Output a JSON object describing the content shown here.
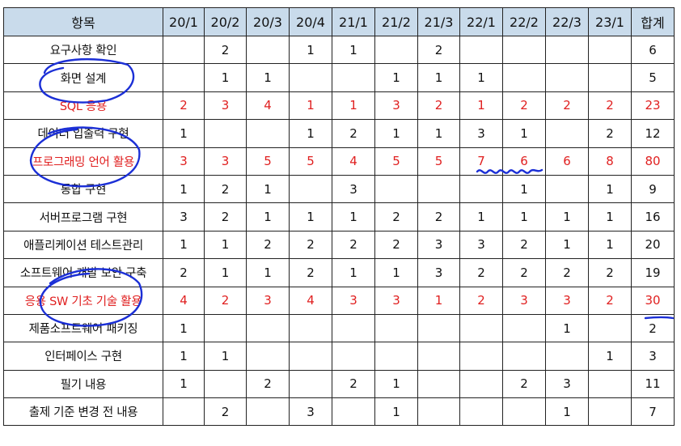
{
  "table": {
    "headers": [
      "항목",
      "20/1",
      "20/2",
      "20/3",
      "20/4",
      "21/1",
      "21/2",
      "21/3",
      "22/1",
      "22/2",
      "22/3",
      "23/1",
      "합계"
    ],
    "rows": [
      {
        "item": "요구사항 확인",
        "values": [
          "",
          "2",
          "",
          "1",
          "1",
          "",
          "2",
          "",
          "",
          "",
          "",
          "6"
        ],
        "highlight": false
      },
      {
        "item": "화면 설계",
        "values": [
          "",
          "1",
          "1",
          "",
          "",
          "1",
          "1",
          "1",
          "",
          "",
          "",
          "5"
        ],
        "highlight": false
      },
      {
        "item": "SQL 응용",
        "values": [
          "2",
          "3",
          "4",
          "1",
          "1",
          "3",
          "2",
          "1",
          "2",
          "2",
          "2",
          "23"
        ],
        "highlight": true
      },
      {
        "item": "데이터 입출력 구현",
        "values": [
          "1",
          "",
          "",
          "1",
          "2",
          "1",
          "1",
          "3",
          "1",
          "",
          "2",
          "12"
        ],
        "highlight": false
      },
      {
        "item": "프로그래밍 언어 활용",
        "values": [
          "3",
          "3",
          "5",
          "5",
          "4",
          "5",
          "5",
          "7",
          "6",
          "6",
          "8",
          "80"
        ],
        "highlight": true
      },
      {
        "item": "통합 구현",
        "values": [
          "1",
          "2",
          "1",
          "",
          "3",
          "",
          "",
          "",
          "1",
          "",
          "1",
          "9"
        ],
        "highlight": false
      },
      {
        "item": "서버프로그램 구현",
        "values": [
          "3",
          "2",
          "1",
          "1",
          "1",
          "2",
          "2",
          "1",
          "1",
          "1",
          "1",
          "16"
        ],
        "highlight": false
      },
      {
        "item": "애플리케이션 테스트관리",
        "values": [
          "1",
          "1",
          "2",
          "2",
          "2",
          "2",
          "3",
          "3",
          "2",
          "1",
          "1",
          "20"
        ],
        "highlight": false
      },
      {
        "item": "소프트웨어 개발 보안 구축",
        "values": [
          "2",
          "1",
          "1",
          "2",
          "1",
          "1",
          "3",
          "2",
          "2",
          "2",
          "2",
          "19"
        ],
        "highlight": false
      },
      {
        "item": "응용 SW 기초 기술 활용",
        "values": [
          "4",
          "2",
          "3",
          "4",
          "3",
          "3",
          "1",
          "2",
          "3",
          "3",
          "2",
          "30"
        ],
        "highlight": true
      },
      {
        "item": "제품소프트웨어 패키징",
        "values": [
          "1",
          "",
          "",
          "",
          "",
          "",
          "",
          "",
          "",
          "1",
          "",
          "2"
        ],
        "highlight": false
      },
      {
        "item": "인터페이스 구현",
        "values": [
          "1",
          "1",
          "",
          "",
          "",
          "",
          "",
          "",
          "",
          "",
          "1",
          "3"
        ],
        "highlight": false
      },
      {
        "item": "필기 내용",
        "values": [
          "1",
          "",
          "2",
          "",
          "2",
          "1",
          "",
          "",
          "2",
          "3",
          "",
          "11"
        ],
        "highlight": false
      },
      {
        "item": "출제 기준 변경 전 내용",
        "values": [
          "",
          "2",
          "",
          "3",
          "",
          "1",
          "",
          "",
          "",
          "1",
          "",
          "7"
        ],
        "highlight": false
      }
    ]
  },
  "colors": {
    "header_bg": "#c9dbeb",
    "highlight_text": "#e02020",
    "ink": "#1b2fd6"
  }
}
